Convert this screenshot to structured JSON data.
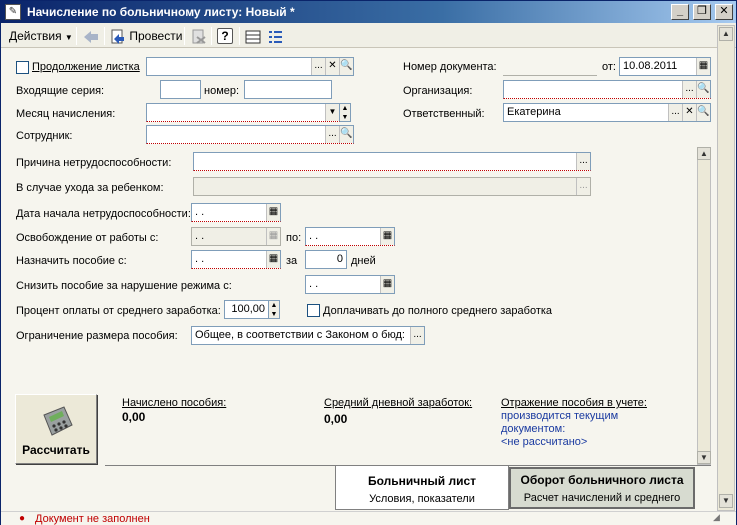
{
  "window": {
    "title": "Начисление по больничному листу: Новый *",
    "icon_glyph": "✎",
    "minimize": "_",
    "restore": "❐",
    "close": "✕"
  },
  "toolbar": {
    "actions_label": "Действия",
    "post_label": "Провести",
    "help_glyph": "?"
  },
  "form": {
    "continuation_label": "Продолжение листка",
    "continuation_value": "",
    "incoming_series_label": "Входящие серия:",
    "incoming_series_value": "",
    "number_label": "номер:",
    "number_value": "",
    "accrual_month_label": "Месяц начисления:",
    "accrual_month_value": "",
    "employee_label": "Сотрудник:",
    "employee_value": "",
    "doc_number_label": "Номер документа:",
    "doc_number_value": "",
    "from_label": "от:",
    "date_value": "10.08.2011",
    "organization_label": "Организация:",
    "organization_value": "",
    "responsible_label": "Ответственный:",
    "responsible_value": "Екатерина",
    "disability_reason_label": "Причина нетрудоспособности:",
    "disability_reason_value": "",
    "child_care_label": "В случае ухода за ребенком:",
    "child_care_value": "",
    "disability_start_label": "Дата начала нетрудоспособности:",
    "disability_start_value": " .  .",
    "release_from_label": "Освобождение от работы с:",
    "release_from_value": " .  .",
    "release_to_label": "по:",
    "release_to_value": " .  .",
    "benefit_from_label": "Назначить пособие с:",
    "benefit_from_value": " .  .",
    "benefit_for_label": "за",
    "benefit_days_value": "0",
    "days_label": "дней",
    "reduce_label": "Снизить пособие за нарушение режима с:",
    "reduce_value": " .  .",
    "percent_label": "Процент оплаты от среднего заработка:",
    "percent_value": "100,00",
    "top_up_label": "Доплачивать до полного среднего заработка",
    "limit_label": "Ограничение размера пособия:",
    "limit_value": "Общее, в соответствии с Законом о бюд:"
  },
  "summary": {
    "calc_button_label": "Рассчитать",
    "accrued_label": "Начислено пособия:",
    "accrued_value": "0,00",
    "avg_daily_label": "Средний дневной заработок:",
    "avg_daily_value": "0,00",
    "accounting_label": "Отражение пособия в учете:",
    "accounting_line1": "производится текущим",
    "accounting_line2": "документом:",
    "accounting_link": "<не рассчитано>"
  },
  "tabs": [
    {
      "title": "Больничный лист",
      "subtitle": "Условия, показатели"
    },
    {
      "title": "Оборот больничного листа",
      "subtitle": "Расчет начислений и среднего"
    }
  ],
  "status": {
    "message": "Документ не заполнен"
  },
  "colors": {
    "title_bar": "#0a246a",
    "link_blue": "#1a3aa0",
    "error_red": "#c00000"
  }
}
